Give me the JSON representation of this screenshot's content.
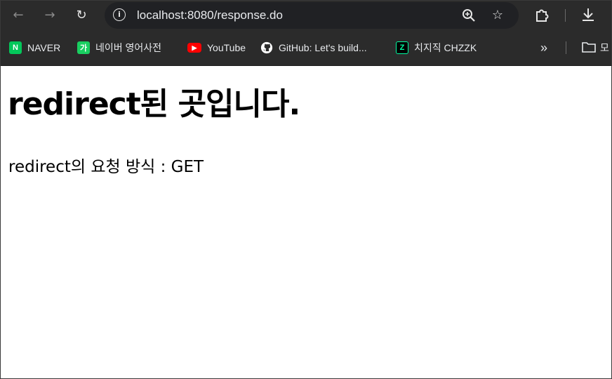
{
  "browser": {
    "url": "localhost:8080/response.do",
    "bookmarks": [
      {
        "label": "NAVER",
        "icon": "naver-icon",
        "badge": "N",
        "color": "#03c75a"
      },
      {
        "label": "네이버 영어사전",
        "icon": "naver-dictionary-icon",
        "badge": "가",
        "color": "#19ce60"
      },
      {
        "label": "YouTube",
        "icon": "youtube-icon",
        "badge": "▶",
        "color": "#ff0000"
      },
      {
        "label": "GitHub: Let's build...",
        "icon": "github-icon",
        "badge": "",
        "color": "#ffffff"
      },
      {
        "label": "치지직 CHZZK",
        "icon": "chzzk-icon",
        "badge": "Z",
        "color": "#00ffa3"
      }
    ],
    "overflow_label": "»",
    "folder_label": "모"
  },
  "page": {
    "heading": "redirect된 곳입니다.",
    "text": "redirect의 요청 방식 : GET"
  }
}
